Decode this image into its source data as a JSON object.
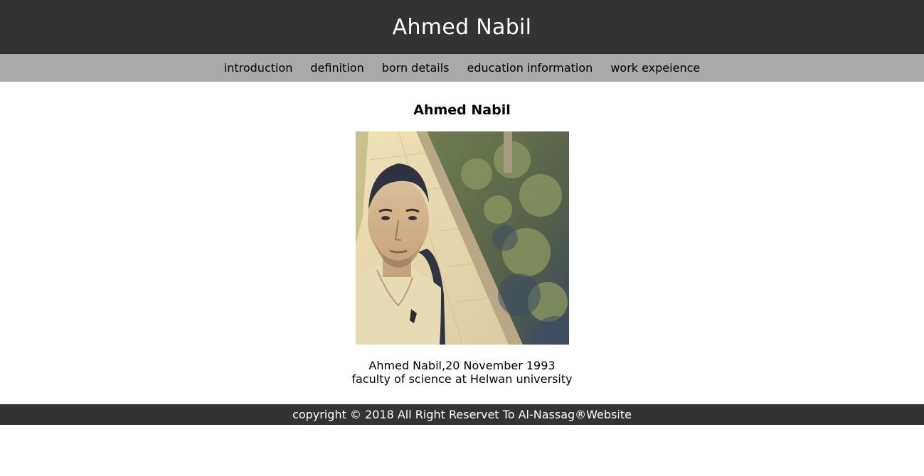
{
  "header": {
    "title": "Ahmed Nabil"
  },
  "nav": {
    "items": [
      {
        "label": "introduction"
      },
      {
        "label": "definition"
      },
      {
        "label": "born details"
      },
      {
        "label": "education information"
      },
      {
        "label": "work expeience"
      }
    ]
  },
  "main": {
    "heading": "Ahmed Nabil",
    "caption_line1": "Ahmed Nabil,20 November 1993",
    "caption_line2": "faculty of science at Helwan university"
  },
  "footer": {
    "text": "copyright © 2018 All Right Reservet To Al-Nassag®Website"
  },
  "colors": {
    "header_bg": "#333333",
    "nav_bg": "#a9a9a9",
    "footer_bg": "#333333"
  }
}
